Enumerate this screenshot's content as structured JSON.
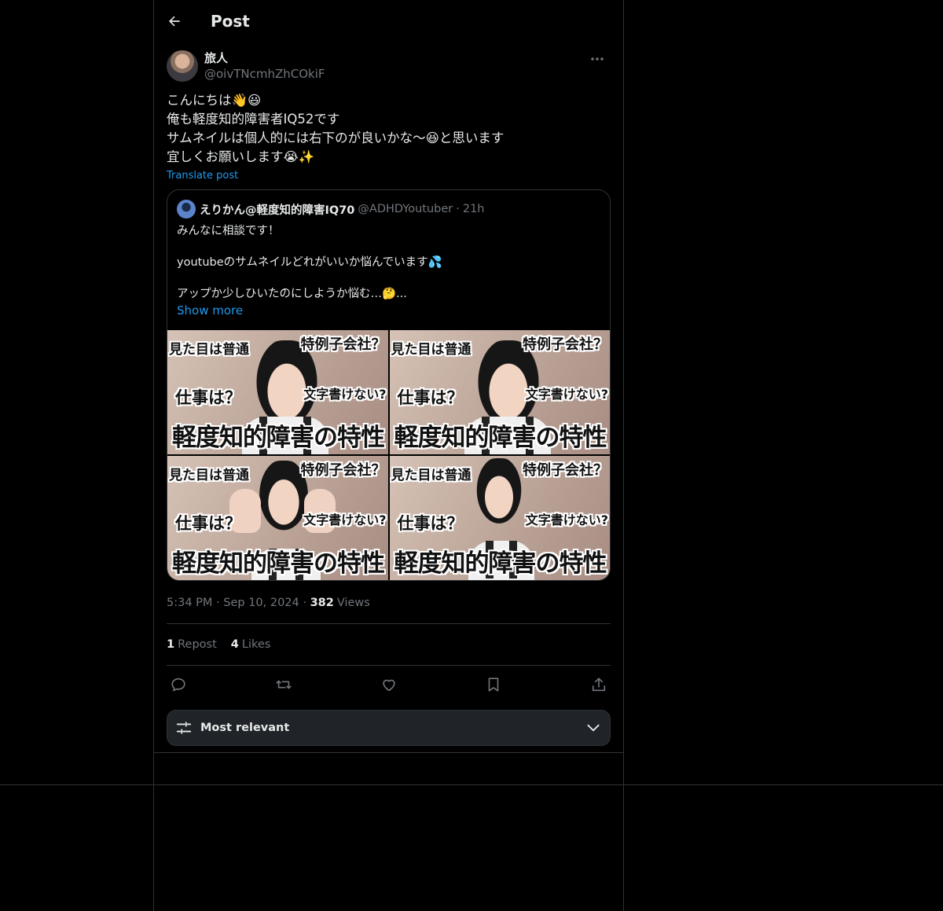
{
  "header": {
    "title": "Post"
  },
  "post": {
    "author_name": "旅人",
    "author_handle": "@oivTNcmhZhCOkiF",
    "text_lines": [
      "こんにちは👋😃",
      "俺も軽度知的障害者IQ52です",
      "サムネイルは個人的には右下のが良いかな〜😆と思います",
      "宜しくお願いします😭✨"
    ],
    "translate_label": "Translate post",
    "timestamp": "5:34 PM · Sep 10, 2024",
    "views_count": "382",
    "views_label": "Views",
    "reposts_count": "1",
    "reposts_label": "Repost",
    "likes_count": "4",
    "likes_label": "Likes"
  },
  "quote": {
    "author_name": "えりかん@軽度知的障害IQ70",
    "author_handle": "@ADHDYoutuber",
    "separator": "·",
    "time": "21h",
    "lines": [
      "みんなに相談です！",
      "",
      "youtubeのサムネイルどれがいいか悩んでいます💦",
      "",
      "アップか少しひいたのにしようか悩む…🤔..."
    ],
    "show_more": "Show more",
    "thumbnails": [
      {
        "t1": "見た目は普通",
        "t2": "特例子会社？",
        "t3": "仕事は？",
        "t4": "文字書けない?",
        "big": "軽度知的障害の特性"
      },
      {
        "t1": "見た目は普通",
        "t2": "特例子会社？",
        "t3": "仕事は？",
        "t4": "文字書けない?",
        "big": "軽度知的障害の特性"
      },
      {
        "t1": "見た目は普通",
        "t2": "特例子会社？",
        "t3": "仕事は？",
        "t4": "文字書けない?",
        "big": "軽度知的障害の特性"
      },
      {
        "t1": "見た目は普通",
        "t2": "特例子会社？",
        "t3": "仕事は？",
        "t4": "文字書けない?",
        "big": "軽度知的障害の特性"
      }
    ]
  },
  "sort": {
    "label": "Most relevant"
  },
  "icons": {
    "back": "arrow-left-icon",
    "more": "more-horizontal-icon",
    "reply": "reply-icon",
    "repost": "repost-icon",
    "like": "heart-icon",
    "bookmark": "bookmark-icon",
    "share": "share-icon",
    "sort": "sliders-icon",
    "chevron": "chevron-down-icon"
  },
  "colors": {
    "accent": "#1d9bf0",
    "muted": "#71767b",
    "text": "#e7e9ea",
    "background": "#000000",
    "border": "#2f3336"
  }
}
